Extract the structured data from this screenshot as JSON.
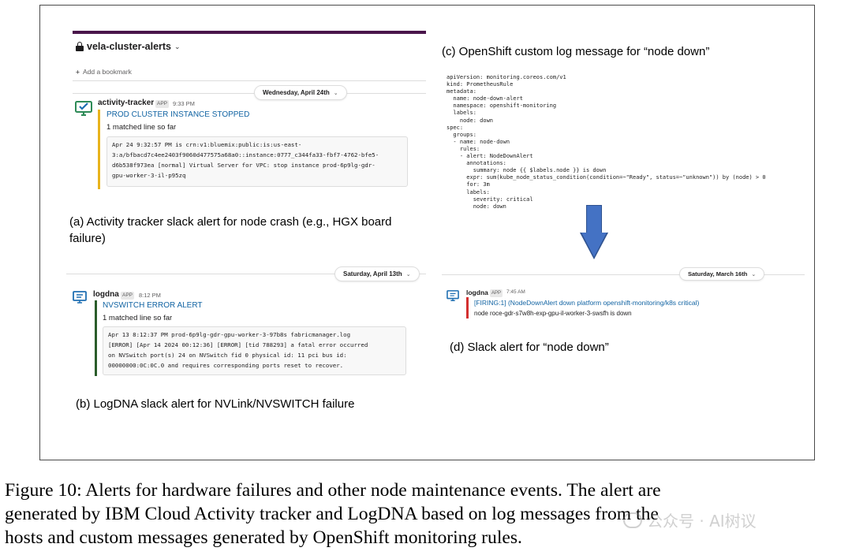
{
  "panel_a": {
    "channel_name": "vela-cluster-alerts",
    "add_bookmark": "Add a bookmark",
    "date_pill": "Wednesday, April 24th",
    "app_name": "activity-tracker",
    "app_badge": "APP",
    "time": "9:33 PM",
    "alert_title": "PROD CLUSTER INSTANCE STOPPED",
    "matched": "1 matched line so far",
    "log_lines": [
      "Apr 24 9:32:57 PM is crn:v1:bluemix:public:is:us-east-",
      "3:a/bfbacd7c4ee2403f9060d477575a68a0::instance:0777_c344fa33-fbf7-4762-bfe5-",
      "d6b538f973ea [normal] Virtual Server for VPC: stop instance prod-6p9lg-gdr-",
      "gpu-worker-3-il-p95zq"
    ],
    "caption_lines": [
      "(a) Activity tracker slack alert for node crash (e.g., HGX board",
      "failure)"
    ]
  },
  "panel_b": {
    "date_pill": "Saturday, April 13th",
    "app_name": "logdna",
    "app_badge": "APP",
    "time": "8:12 PM",
    "alert_title": "NVSWITCH ERROR ALERT",
    "matched": "1 matched line so far",
    "log_lines": [
      "Apr 13 8:12:37 PM prod-6p9lg-gdr-gpu-worker-3-97b8s fabricmanager.log",
      "[ERROR] [Apr 14 2024 00:12:36] [ERROR] [tid 788293] a fatal error occurred",
      "on NVSwitch port(s) 24 on NVSwitch fid 0 physical id: 11 pci bus id:",
      "00000000:0C:0C.0 and requires corresponding ports reset to recover."
    ],
    "caption": "(b) LogDNA slack alert for NVLink/NVSWITCH failure"
  },
  "panel_c": {
    "caption": "(c) OpenShift custom log message for “node down”",
    "yaml_lines": [
      "apiVersion: monitoring.coreos.com/v1",
      "kind: PrometheusRule",
      "metadata:",
      "  name: node-down-alert",
      "  namespace: openshift-monitoring",
      "  labels:",
      "    node: down",
      "spec:",
      "  groups:",
      "  - name: node-down",
      "    rules:",
      "    - alert: NodeDownAlert",
      "      annotations:",
      "        summary: node {{ $labels.node }} is down",
      "      expr: sum(kube_node_status_condition(condition=~\"Ready\", status=~\"unknown\")) by (node) > 0",
      "      for: 3m",
      "      labels:",
      "        severity: critical",
      "        node: down"
    ]
  },
  "panel_d": {
    "date_pill": "Saturday, March 16th",
    "app_name": "logdna",
    "app_badge": "APP",
    "time": "7:45 AM",
    "firing": "[FIRING:1]  (NodeDownAlert down platform openshift-monitoring/k8s critical)",
    "node_line": "node roce-gdr-s7w8h-exp-gpu-il-worker-3-swsfh is down",
    "caption": "(d) Slack alert for “node down”"
  },
  "figure_caption": {
    "lines": [
      "Figure 10: Alerts for hardware failures and other node maintenance events. The alert are",
      "generated by IBM Cloud Activity tracker and LogDNA based on log messages from the",
      "hosts and custom messages generated by OpenShift monitoring rules."
    ]
  },
  "watermark": "公众号 · AI树议",
  "colors": {
    "link_blue": "#1264a3",
    "activity_bar": "#e8b31c",
    "logdna_bar": "#2a5c2a",
    "firing_bar": "#d32f2f",
    "arrow_blue": "#4472c4",
    "channel_purple": "#4a154b"
  },
  "icons": {
    "channel": "lock-icon",
    "activity_tracker": "monitor-check-icon",
    "logdna": "monitor-list-icon"
  }
}
